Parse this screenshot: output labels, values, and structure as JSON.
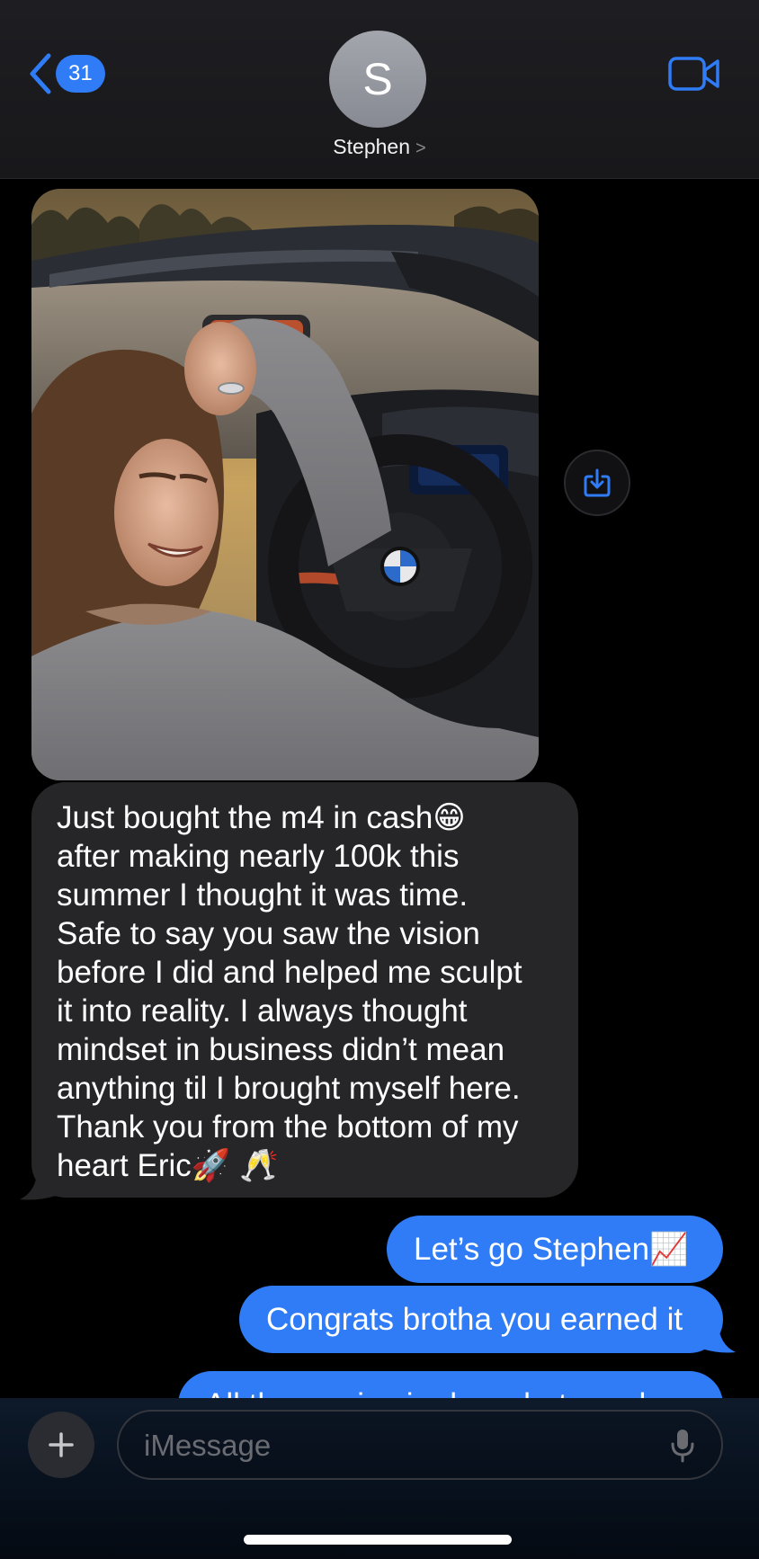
{
  "header": {
    "back_badge": "31",
    "avatar_initial": "S",
    "contact_name": "Stephen",
    "contact_chevron": ">"
  },
  "messages": {
    "photo": {
      "icon": "car-selfie-photo"
    },
    "received_text": "Just bought the m4 in cash😁\nafter making nearly 100k this\nsummer I thought it was time.\nSafe to say you saw the vision\nbefore I did and helped me sculpt\nit into reality. I always thought\nmindset in business didn’t mean\nanything til I brought myself here.\nThank you from the bottom of my\nheart Eric🚀 🥂",
    "sent": [
      {
        "text": "Let’s go Stephen📈"
      },
      {
        "text": "Congrats brotha you earned it"
      },
      {
        "text": "All these wins in due what needs"
      }
    ]
  },
  "composer": {
    "placeholder": "iMessage",
    "plus_label": "+"
  },
  "colors": {
    "accent": "#2f7cf6",
    "received_bubble": "#262628",
    "background": "#000000"
  },
  "icons": [
    "chevron-left-icon",
    "video-camera-icon",
    "save-download-icon",
    "plus-icon",
    "microphone-icon"
  ]
}
